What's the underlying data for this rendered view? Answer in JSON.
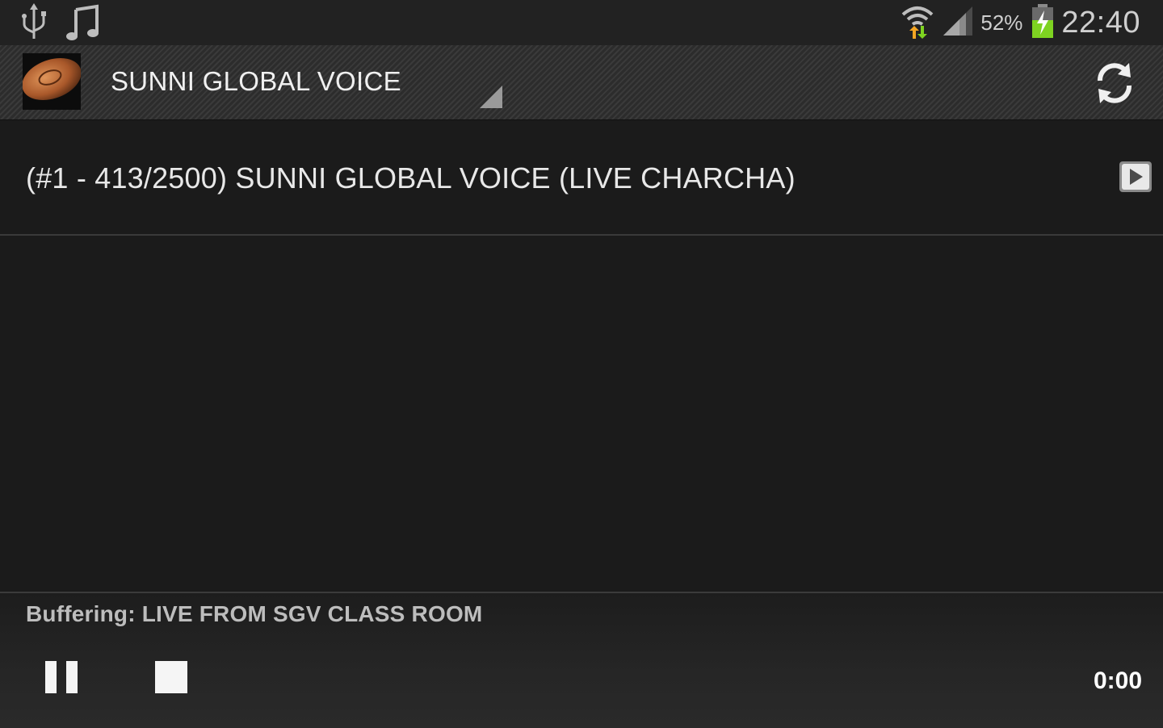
{
  "status_bar": {
    "icons_left": [
      "usb-icon",
      "music-note-icon"
    ],
    "icons_right": [
      "wifi-icon",
      "signal-icon",
      "battery-charging-icon"
    ],
    "battery_percent": "52%",
    "time": "22:40"
  },
  "action_bar": {
    "title": "SUNNI GLOBAL VOICE",
    "logo_icon": "app-logo-icon",
    "refresh_icon": "refresh-icon"
  },
  "list": {
    "items": [
      {
        "label": "(#1 - 413/2500) SUNNI GLOBAL VOICE (LIVE CHARCHA)",
        "action_icon": "play-icon"
      }
    ]
  },
  "player": {
    "status": "Buffering: LIVE FROM SGV CLASS ROOM",
    "elapsed": "0:00",
    "pause_icon": "pause-icon",
    "stop_icon": "stop-icon"
  },
  "colors": {
    "background": "#1b1b1b",
    "battery_charge": "#7ed321",
    "wifi_arrow_up": "#f5a623",
    "wifi_arrow_down": "#7ed321"
  }
}
